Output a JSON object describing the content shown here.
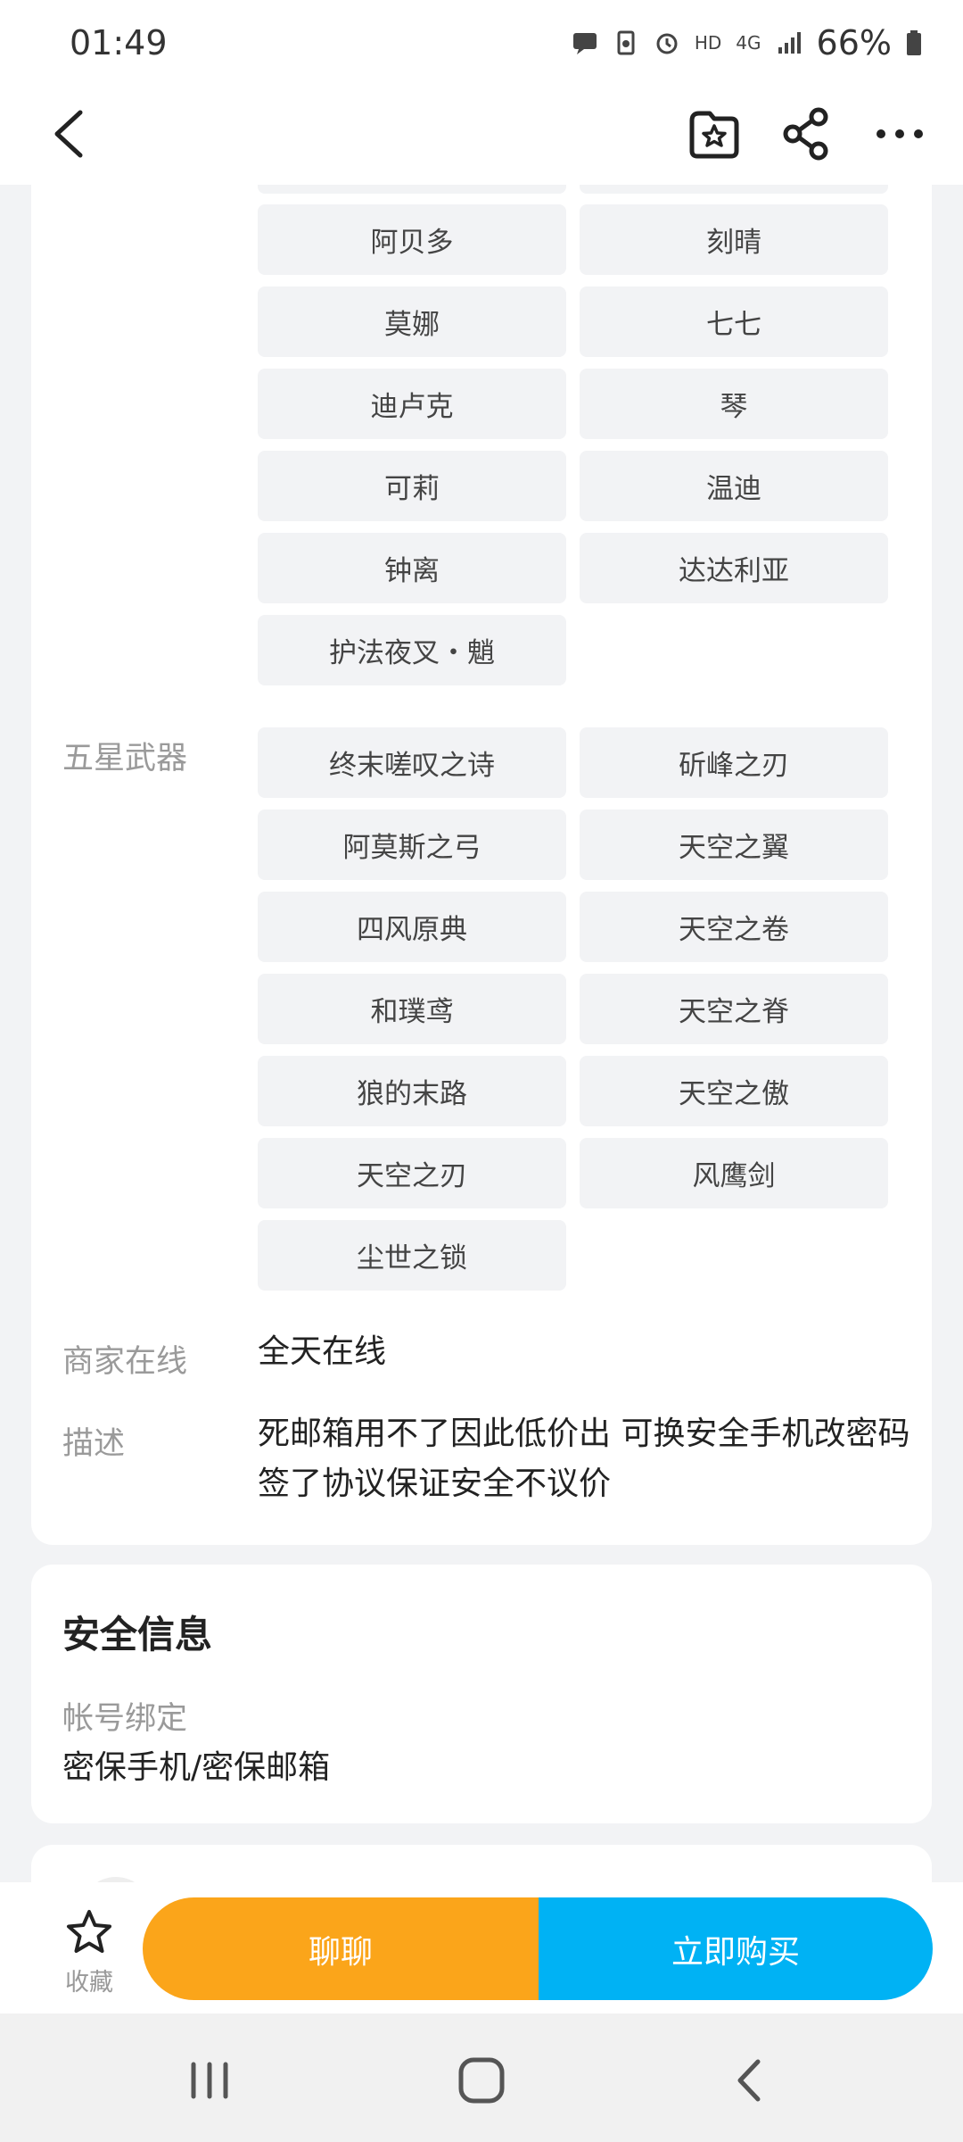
{
  "status_bar": {
    "time": "01:49",
    "network": "HD",
    "signal": "4G",
    "battery": "66%"
  },
  "header": {
    "back_icon": "back-arrow-icon",
    "favorite_icon": "star-folder-icon",
    "share_icon": "share-icon",
    "more_icon": "more-icon"
  },
  "characters": [
    "阿贝多",
    "刻晴",
    "莫娜",
    "七七",
    "迪卢克",
    "琴",
    "可莉",
    "温迪",
    "钟离",
    "达达利亚",
    "护法夜叉・魈"
  ],
  "weapons": {
    "label": "五星武器",
    "items": [
      "终末嗟叹之诗",
      "斫峰之刃",
      "阿莫斯之弓",
      "天空之翼",
      "四风原典",
      "天空之卷",
      "和璞鸢",
      "天空之脊",
      "狼的末路",
      "天空之傲",
      "天空之刃",
      "风鹰剑",
      "尘世之锁"
    ]
  },
  "merchant_online": {
    "label": "商家在线",
    "value": "全天在线"
  },
  "description": {
    "label": "描述",
    "value": "死邮箱用不了因此低价出 可换安全手机改密码 签了协议保证安全不议价"
  },
  "security": {
    "title": "安全信息",
    "binding_label": "帐号绑定",
    "binding_value": "密保手机/密保邮箱"
  },
  "bottom_bar": {
    "favorite_label": "收藏",
    "chat_label": "聊聊",
    "buy_label": "立即购买"
  },
  "colors": {
    "chat": "#fba51a",
    "buy": "#00b2f4",
    "tag_bg": "#f2f3f5"
  }
}
